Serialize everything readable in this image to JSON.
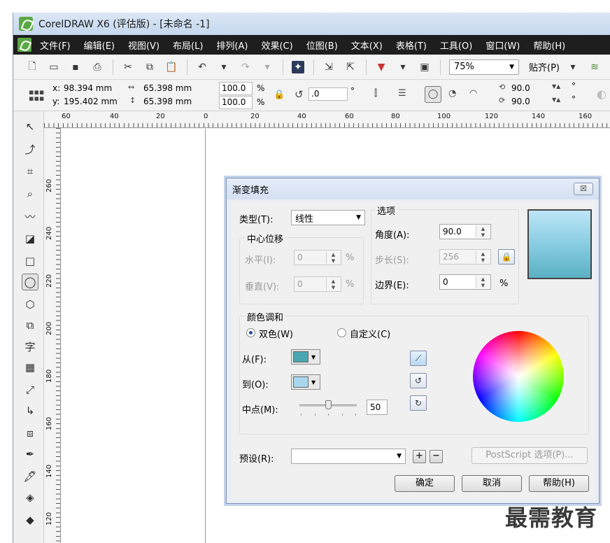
{
  "window": {
    "title": "CorelDRAW X6 (评估版) - [未命名 -1]"
  },
  "menu": [
    "文件(F)",
    "编辑(E)",
    "视图(V)",
    "布局(L)",
    "排列(A)",
    "效果(C)",
    "位图(B)",
    "文本(X)",
    "表格(T)",
    "工具(O)",
    "窗口(W)",
    "帮助(H)"
  ],
  "toolbar": {
    "zoom": "75%",
    "snap_label": "贴齐(P)"
  },
  "props": {
    "x_label": "x:",
    "x_value": "98.394 mm",
    "y_label": "y:",
    "y_value": "195.402 mm",
    "w_value": "65.398 mm",
    "h_value": "65.398 mm",
    "scale_x": "100.0",
    "scale_y": "100.0",
    "pct": "%",
    "rotation": ".0",
    "deg": "°",
    "angle1": "90.0",
    "angle2": "90.0"
  },
  "ruler_h": [
    "60",
    "40",
    "20",
    "0",
    "20",
    "40",
    "60",
    "80",
    "100",
    "120",
    "140",
    "160"
  ],
  "ruler_v": [
    "260",
    "240",
    "220",
    "200",
    "180",
    "160",
    "140",
    "120"
  ],
  "dialog": {
    "title": "渐变填充",
    "close": "☒",
    "type_label": "类型(T):",
    "type_value": "线性",
    "center_group": "中心位移",
    "horizontal_label": "水平(I):",
    "horizontal_value": "0",
    "vertical_label": "垂直(V):",
    "vertical_value": "0",
    "options_group": "选项",
    "angle_label": "角度(A):",
    "angle_value": "90.0",
    "steps_label": "步长(S):",
    "steps_value": "256",
    "edge_label": "边界(E):",
    "edge_value": "0",
    "pct": "%",
    "blend_group": "颜色调和",
    "two_color_label": "双色(W)",
    "custom_label": "自定义(C)",
    "from_label": "从(F):",
    "from_color": "#4aa6b0",
    "to_label": "到(O):",
    "to_color": "#a8d8f0",
    "mid_label": "中点(M):",
    "mid_value": "50",
    "preset_label": "预设(R):",
    "preset_value": "",
    "postscript_button": "PostScript 选项(P)...",
    "ok_button": "确定",
    "cancel_button": "取消",
    "help_button": "帮助(H)"
  },
  "watermark": "最需教育"
}
